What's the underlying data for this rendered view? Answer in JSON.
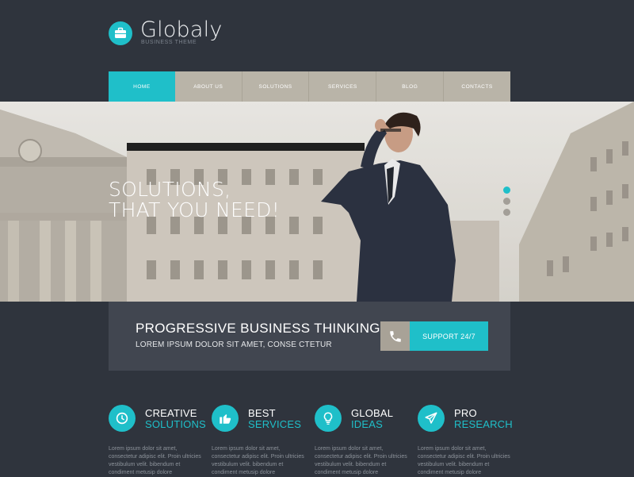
{
  "logo": {
    "title": "Globaly",
    "subtitle": "BUSINESS THEME",
    "icon": "briefcase-icon"
  },
  "nav": {
    "items": [
      {
        "label": "HOME",
        "active": true
      },
      {
        "label": "ABOUT US",
        "active": false
      },
      {
        "label": "SOLUTIONS",
        "active": false
      },
      {
        "label": "SERVICES",
        "active": false
      },
      {
        "label": "BLOG",
        "active": false
      },
      {
        "label": "CONTACTS",
        "active": false
      }
    ]
  },
  "hero": {
    "line1": "SOLUTIONS,",
    "line2": "THAT YOU NEED!",
    "slides": 3,
    "active_slide": 1
  },
  "band": {
    "title": "PROGRESSIVE BUSINESS THINKING",
    "subtitle": "LOREM IPSUM DOLOR SIT AMET, CONSE CTETUR",
    "support_label": "SUPPORT 24/7",
    "support_icon": "phone-icon"
  },
  "features": [
    {
      "icon": "clock-icon",
      "line1": "CREATIVE",
      "line2": "SOLUTIONS",
      "text": "Lorem ipsum dolor sit amet, consectetur adipisc elit. Proin ultricies vestibulum velit. bibendum et condiment metusip dolore"
    },
    {
      "icon": "thumbs-up-icon",
      "line1": "BEST",
      "line2": "SERVICES",
      "text": "Lorem ipsum dolor sit amet, consectetur adipisc elit. Proin ultricies vestibulum velit. bibendum et condiment metusip dolore"
    },
    {
      "icon": "lightbulb-icon",
      "line1": "GLOBAL",
      "line2": "IDEAS",
      "text": "Lorem ipsum dolor sit amet, consectetur adipisc elit. Proin ultricies vestibulum velit. bibendum et condiment metusip dolore"
    },
    {
      "icon": "paper-plane-icon",
      "line1": "PRO",
      "line2": "RESEARCH",
      "text": "Lorem ipsum dolor sit amet, consectetur adipisc elit. Proin ultricies vestibulum velit. bibendum et condiment metusip dolore"
    }
  ],
  "colors": {
    "accent": "#1fbfc9",
    "background": "#2f343d",
    "nav": "#b9b4a8",
    "band": "#414650"
  }
}
